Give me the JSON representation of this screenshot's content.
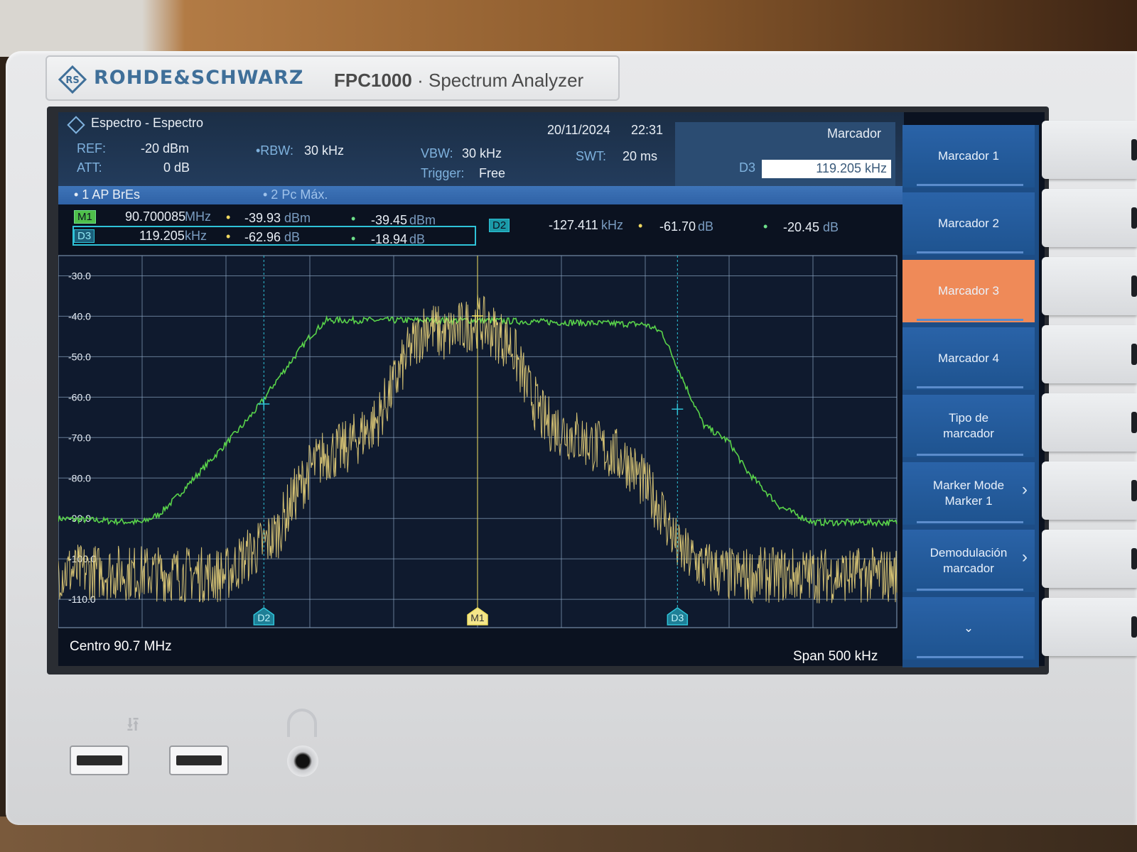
{
  "brand": {
    "name": "ROHDE&SCHWARZ",
    "model": "FPC1000",
    "separator": "·",
    "product": "Spectrum Analyzer"
  },
  "header": {
    "title": "Espectro - Espectro",
    "date": "20/11/2024",
    "time": "22:31",
    "panel_title": "Marcador",
    "ref_label": "REF:",
    "ref_value": "-20 dBm",
    "att_label": "ATT:",
    "att_value": "0 dB",
    "rbw_label": "•RBW:",
    "rbw_value": "30 kHz",
    "vbw_label": "VBW:",
    "vbw_value": "30 kHz",
    "trigger_label": "Trigger:",
    "trigger_value": "Free",
    "swt_label": "SWT:",
    "swt_value": "20 ms",
    "entry_label": "D3",
    "entry_value": "119.205 kHz"
  },
  "traces": {
    "t1": "• 1 AP  BrEs",
    "t2": "• 2 Pc  Máx."
  },
  "markers": {
    "m1": {
      "tag": "M1",
      "freq": "90.700085",
      "freq_unit": "MHz",
      "v1": "-39.93",
      "v1_unit": "dBm",
      "v2": "-39.45",
      "v2_unit": "dBm"
    },
    "d3": {
      "tag": "D3",
      "freq": "119.205",
      "freq_unit": "kHz",
      "v1": "-62.96",
      "v1_unit": "dB",
      "v2": "-18.94",
      "v2_unit": "dB"
    },
    "d2": {
      "tag": "D2",
      "freq": "-127.411",
      "freq_unit": "kHz",
      "v1": "-61.70",
      "v1_unit": "dB",
      "v2": "-20.45",
      "v2_unit": "dB"
    }
  },
  "footer": {
    "center": "Centro 90.7 MHz",
    "span": "Span 500 kHz"
  },
  "softkeys": [
    {
      "label": "Marcador 1",
      "label2": "",
      "active": false,
      "arrow": ""
    },
    {
      "label": "Marcador 2",
      "label2": "",
      "active": false,
      "arrow": ""
    },
    {
      "label": "Marcador 3",
      "label2": "",
      "active": true,
      "arrow": ""
    },
    {
      "label": "Marcador 4",
      "label2": "",
      "active": false,
      "arrow": ""
    },
    {
      "label": "Tipo de",
      "label2": "marcador",
      "active": false,
      "arrow": ""
    },
    {
      "label": "Marker Mode",
      "label2": "Marker 1",
      "active": false,
      "arrow": "›"
    },
    {
      "label": "Demodulación",
      "label2": "marcador",
      "active": false,
      "arrow": "›"
    },
    {
      "label": "⌄",
      "label2": "",
      "active": false,
      "arrow": ""
    }
  ],
  "colors": {
    "trace_max": "#59d34a",
    "trace_avg": "#e8d27a",
    "grid": "#8aa3c0",
    "marker_delta": "#2fc3d8",
    "marker_main": "#f0e060",
    "active_softkey": "#ef8a58"
  },
  "chart_data": {
    "type": "line",
    "title": "",
    "xlabel": "",
    "ylabel": "",
    "y_ticks": [
      "-30.0",
      "-40.0",
      "-50.0",
      "-60.0",
      "-70.0",
      "-80.0",
      "-90.0",
      "-100.0",
      "-110.0"
    ],
    "xlim": [
      -250,
      250
    ],
    "x_unit": "kHz offset from 90.7 MHz",
    "ylim": [
      -117,
      -25
    ],
    "grid": true,
    "series": [
      {
        "name": "2 Pc Máx.",
        "x": [
          -250,
          -200,
          -190,
          -180,
          -160,
          -140,
          -130,
          -120,
          -100,
          -90,
          0,
          100,
          110,
          125,
          135,
          150,
          160,
          180,
          200,
          250
        ],
        "values": [
          -90,
          -91,
          -89,
          -85,
          -76,
          -67,
          -62,
          -56,
          -45,
          -41,
          -41,
          -42,
          -44,
          -58,
          -67,
          -71,
          -78,
          -87,
          -91,
          -91
        ]
      },
      {
        "name": "1 AP BrEs",
        "x": [
          -250,
          -150,
          -140,
          -120,
          -110,
          -100,
          -90,
          -80,
          -60,
          -40,
          -30,
          -20,
          0,
          20,
          30,
          40,
          60,
          70,
          80,
          90,
          100,
          110,
          120,
          135,
          150,
          250
        ],
        "values": [
          -103,
          -104,
          -100,
          -94,
          -85,
          -78,
          -74,
          -73,
          -66,
          -48,
          -42,
          -45,
          -41,
          -47,
          -58,
          -66,
          -70,
          -72,
          -74,
          -76,
          -82,
          -88,
          -98,
          -102,
          -104,
          -104
        ]
      }
    ],
    "markers": [
      {
        "name": "M1",
        "x": 0,
        "y": -39.93
      },
      {
        "name": "D2",
        "x": -127.411,
        "y": -61.7
      },
      {
        "name": "D3",
        "x": 119.205,
        "y": -62.96
      }
    ]
  }
}
